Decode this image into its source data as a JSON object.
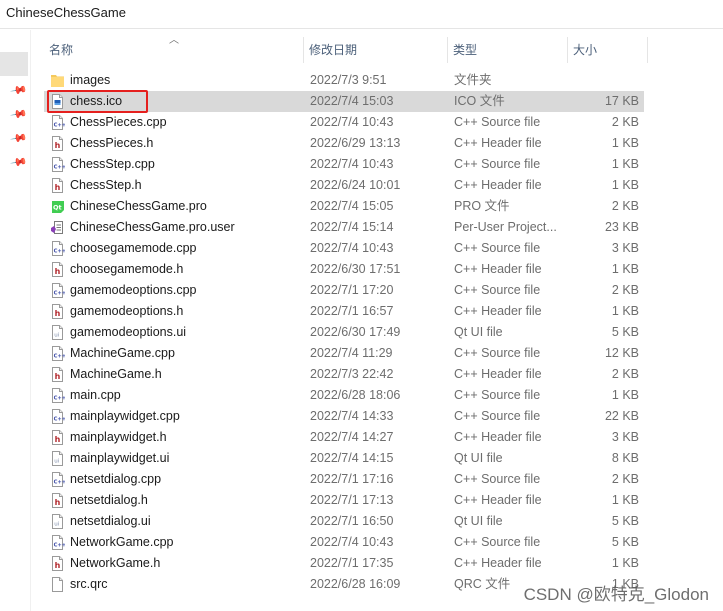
{
  "window": {
    "title": "ChineseChessGame"
  },
  "columns": {
    "name": "名称",
    "date": "修改日期",
    "type": "类型",
    "size": "大小"
  },
  "sort": {
    "column": "name",
    "direction": "ascending",
    "indicator_icon": "chevron-up-icon"
  },
  "nav_pins": [
    "pin-icon",
    "pin-icon",
    "pin-icon",
    "pin-icon"
  ],
  "files": [
    {
      "name": "images",
      "date": "2022/7/3 9:51",
      "type": "文件夹",
      "size": "",
      "icon": "folder-icon"
    },
    {
      "name": "chess.ico",
      "date": "2022/7/4 15:03",
      "type": "ICO 文件",
      "size": "17 KB",
      "icon": "image-file-icon",
      "selected": true,
      "highlighted": true
    },
    {
      "name": "ChessPieces.cpp",
      "date": "2022/7/4 10:43",
      "type": "C++ Source file",
      "size": "2 KB",
      "icon": "cpp-file-icon"
    },
    {
      "name": "ChessPieces.h",
      "date": "2022/6/29 13:13",
      "type": "C++ Header file",
      "size": "1 KB",
      "icon": "header-file-icon"
    },
    {
      "name": "ChessStep.cpp",
      "date": "2022/7/4 10:43",
      "type": "C++ Source file",
      "size": "1 KB",
      "icon": "cpp-file-icon"
    },
    {
      "name": "ChessStep.h",
      "date": "2022/6/24 10:01",
      "type": "C++ Header file",
      "size": "1 KB",
      "icon": "header-file-icon"
    },
    {
      "name": "ChineseChessGame.pro",
      "date": "2022/7/4 15:05",
      "type": "PRO 文件",
      "size": "2 KB",
      "icon": "qt-project-icon"
    },
    {
      "name": "ChineseChessGame.pro.user",
      "date": "2022/7/4 15:14",
      "type": "Per-User Project...",
      "size": "23 KB",
      "icon": "user-project-icon"
    },
    {
      "name": "choosegamemode.cpp",
      "date": "2022/7/4 10:43",
      "type": "C++ Source file",
      "size": "3 KB",
      "icon": "cpp-file-icon"
    },
    {
      "name": "choosegamemode.h",
      "date": "2022/6/30 17:51",
      "type": "C++ Header file",
      "size": "1 KB",
      "icon": "header-file-icon"
    },
    {
      "name": "gamemodeoptions.cpp",
      "date": "2022/7/1 17:20",
      "type": "C++ Source file",
      "size": "2 KB",
      "icon": "cpp-file-icon"
    },
    {
      "name": "gamemodeoptions.h",
      "date": "2022/7/1 16:57",
      "type": "C++ Header file",
      "size": "1 KB",
      "icon": "header-file-icon"
    },
    {
      "name": "gamemodeoptions.ui",
      "date": "2022/6/30 17:49",
      "type": "Qt UI file",
      "size": "5 KB",
      "icon": "ui-file-icon"
    },
    {
      "name": "MachineGame.cpp",
      "date": "2022/7/4 11:29",
      "type": "C++ Source file",
      "size": "12 KB",
      "icon": "cpp-file-icon"
    },
    {
      "name": "MachineGame.h",
      "date": "2022/7/3 22:42",
      "type": "C++ Header file",
      "size": "2 KB",
      "icon": "header-file-icon"
    },
    {
      "name": "main.cpp",
      "date": "2022/6/28 18:06",
      "type": "C++ Source file",
      "size": "1 KB",
      "icon": "cpp-file-icon"
    },
    {
      "name": "mainplaywidget.cpp",
      "date": "2022/7/4 14:33",
      "type": "C++ Source file",
      "size": "22 KB",
      "icon": "cpp-file-icon"
    },
    {
      "name": "mainplaywidget.h",
      "date": "2022/7/4 14:27",
      "type": "C++ Header file",
      "size": "3 KB",
      "icon": "header-file-icon"
    },
    {
      "name": "mainplaywidget.ui",
      "date": "2022/7/4 14:15",
      "type": "Qt UI file",
      "size": "8 KB",
      "icon": "ui-file-icon"
    },
    {
      "name": "netsetdialog.cpp",
      "date": "2022/7/1 17:16",
      "type": "C++ Source file",
      "size": "2 KB",
      "icon": "cpp-file-icon"
    },
    {
      "name": "netsetdialog.h",
      "date": "2022/7/1 17:13",
      "type": "C++ Header file",
      "size": "1 KB",
      "icon": "header-file-icon"
    },
    {
      "name": "netsetdialog.ui",
      "date": "2022/7/1 16:50",
      "type": "Qt UI file",
      "size": "5 KB",
      "icon": "ui-file-icon"
    },
    {
      "name": "NetworkGame.cpp",
      "date": "2022/7/4 10:43",
      "type": "C++ Source file",
      "size": "5 KB",
      "icon": "cpp-file-icon"
    },
    {
      "name": "NetworkGame.h",
      "date": "2022/7/1 17:35",
      "type": "C++ Header file",
      "size": "1 KB",
      "icon": "header-file-icon"
    },
    {
      "name": "src.qrc",
      "date": "2022/6/28 16:09",
      "type": "QRC 文件",
      "size": "1 KB",
      "icon": "generic-file-icon"
    }
  ],
  "watermark": "CSDN @欧特克_Glodon"
}
